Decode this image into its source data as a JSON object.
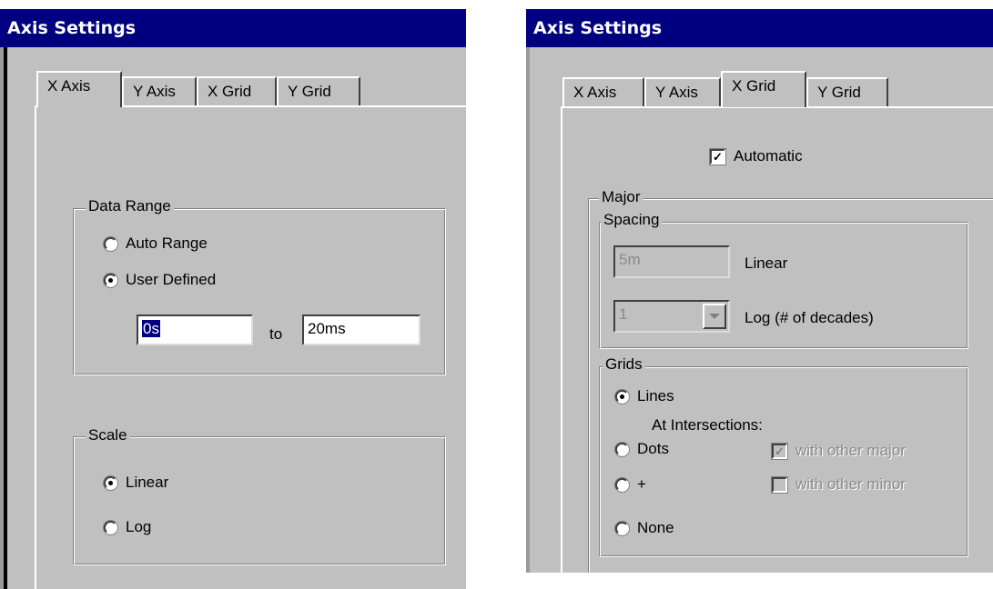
{
  "left": {
    "title": "Axis Settings",
    "tabs": [
      {
        "label": "X Axis",
        "active": true
      },
      {
        "label": "Y Axis",
        "active": false
      },
      {
        "label": "X Grid",
        "active": false
      },
      {
        "label": "Y Grid",
        "active": false
      }
    ],
    "data_range": {
      "legend": "Data Range",
      "auto_range": "Auto Range",
      "user_defined": "User Defined",
      "selected": "User Defined",
      "from_value": "0s",
      "to_label": "to",
      "to_value": "20ms"
    },
    "scale": {
      "legend": "Scale",
      "linear": "Linear",
      "log": "Log",
      "selected": "Linear"
    }
  },
  "right": {
    "title": "Axis Settings",
    "tabs": [
      {
        "label": "X Axis",
        "active": false
      },
      {
        "label": "Y Axis",
        "active": false
      },
      {
        "label": "X Grid",
        "active": true
      },
      {
        "label": "Y Grid",
        "active": false
      }
    ],
    "automatic_label": "Automatic",
    "automatic_checked": true,
    "major": {
      "legend": "Major",
      "spacing": {
        "legend": "Spacing",
        "linear_value": "5m",
        "linear_label": "Linear",
        "log_value": "1",
        "log_label": "Log (# of decades)"
      },
      "grids": {
        "legend": "Grids",
        "lines": "Lines",
        "at_intersections": "At Intersections:",
        "dots": "Dots",
        "plus": "+",
        "none": "None",
        "selected": "Lines",
        "with_other_major": "with other major",
        "with_other_major_checked": true,
        "with_other_minor": "with other minor",
        "with_other_minor_checked": false
      }
    }
  }
}
